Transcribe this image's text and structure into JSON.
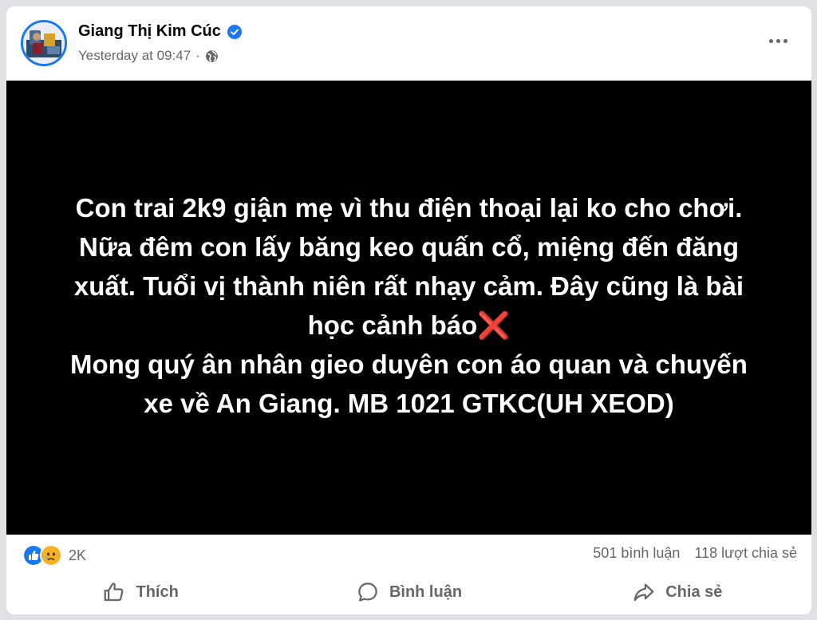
{
  "post": {
    "author": "Giang Thị Kim Cúc",
    "timestamp": "Yesterday at 09:47",
    "meta_separator": "·",
    "verified": true,
    "privacy_icon": "globe-icon",
    "more_icon": "more-options-icon"
  },
  "image_text": "Con trai 2k9 giận mẹ vì thu điện thoại lại ko cho chơi.\nNữa đêm con lấy băng keo quấn cổ, miệng đến đăng\nxuất. Tuổi vị thành niên rất nhạy cảm. Đây cũng là bài\nhọc cảnh báo❌\nMong quý ân nhân gieo duyên con áo quan và chuyến\nxe về An Giang. MB 1021 GTKC(UH XEOD)",
  "stats": {
    "reaction_icons": [
      "like-icon",
      "sad-icon"
    ],
    "reactions_count": "2K",
    "comments": "501 bình luận",
    "shares": "118 lượt chia sẻ"
  },
  "actions": {
    "like": "Thích",
    "comment": "Bình luận",
    "share": "Chia sẻ"
  },
  "colors": {
    "accent": "#1877f2",
    "secondary_text": "#65676b",
    "image_background": "#000000"
  }
}
